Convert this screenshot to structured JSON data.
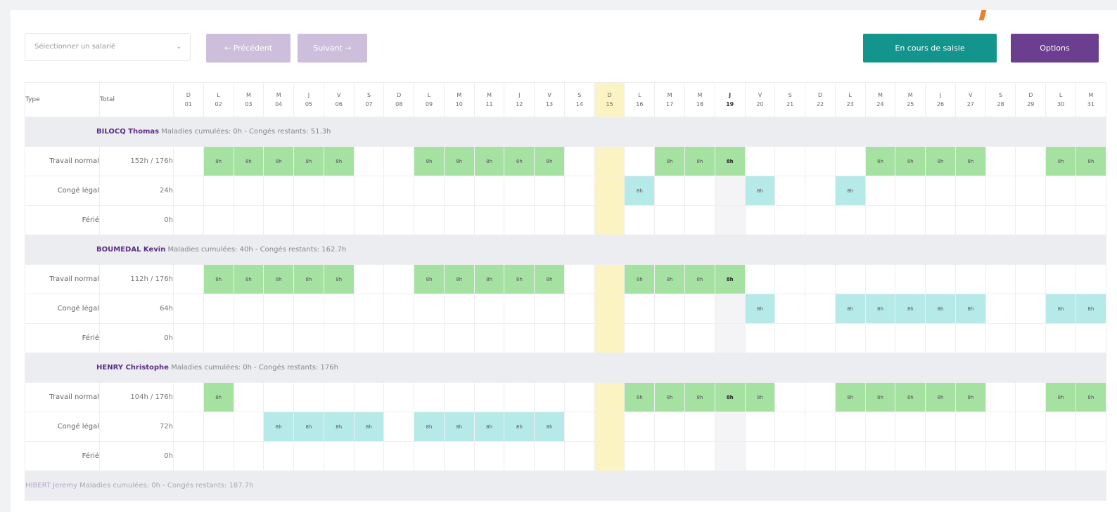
{
  "toolbar": {
    "select_placeholder": "Sélectionner un salarié",
    "prev_label": "← Précédent",
    "next_label": "Suivant →",
    "status_label": "En cours de saisie",
    "options_label": "Options"
  },
  "columns": {
    "type": "Type",
    "total": "Total"
  },
  "days": [
    {
      "l": "D",
      "n": "01"
    },
    {
      "l": "L",
      "n": "02"
    },
    {
      "l": "M",
      "n": "03"
    },
    {
      "l": "M",
      "n": "04"
    },
    {
      "l": "J",
      "n": "05"
    },
    {
      "l": "V",
      "n": "06"
    },
    {
      "l": "S",
      "n": "07"
    },
    {
      "l": "D",
      "n": "08"
    },
    {
      "l": "L",
      "n": "09"
    },
    {
      "l": "M",
      "n": "10"
    },
    {
      "l": "M",
      "n": "11"
    },
    {
      "l": "J",
      "n": "12"
    },
    {
      "l": "V",
      "n": "13"
    },
    {
      "l": "S",
      "n": "14"
    },
    {
      "l": "D",
      "n": "15"
    },
    {
      "l": "L",
      "n": "16"
    },
    {
      "l": "M",
      "n": "17"
    },
    {
      "l": "M",
      "n": "18"
    },
    {
      "l": "J",
      "n": "19"
    },
    {
      "l": "V",
      "n": "20"
    },
    {
      "l": "S",
      "n": "21"
    },
    {
      "l": "D",
      "n": "22"
    },
    {
      "l": "L",
      "n": "23"
    },
    {
      "l": "M",
      "n": "24"
    },
    {
      "l": "M",
      "n": "25"
    },
    {
      "l": "J",
      "n": "26"
    },
    {
      "l": "V",
      "n": "27"
    },
    {
      "l": "S",
      "n": "28"
    },
    {
      "l": "D",
      "n": "29"
    },
    {
      "l": "L",
      "n": "30"
    },
    {
      "l": "M",
      "n": "31"
    }
  ],
  "holiday_day": "15",
  "current_day": "19",
  "colors": {
    "work": "#a5e2a1",
    "leave": "#b6eae9",
    "holiday": "#fbf4c2",
    "brand": "#6c3e8f",
    "status": "#13958d"
  },
  "employees": [
    {
      "name": "BILOCQ Thomas",
      "info": "Maladies cumulées: 0h - Congés restants: 51.3h",
      "rows": [
        {
          "type": "Travail normal",
          "total": "152h / 176h",
          "kind": "w",
          "days": [
            "02",
            "03",
            "04",
            "05",
            "06",
            "09",
            "10",
            "11",
            "12",
            "13",
            "17",
            "18",
            "19",
            "24",
            "25",
            "26",
            "27",
            "30",
            "31"
          ]
        },
        {
          "type": "Congé légal",
          "total": "24h",
          "kind": "l",
          "days": [
            "16",
            "20",
            "23"
          ]
        },
        {
          "type": "Férié",
          "total": "0h",
          "kind": "w",
          "days": []
        }
      ]
    },
    {
      "name": "BOUMEDAL Kevin",
      "info": "Maladies cumulées: 40h - Congés restants: 162.7h",
      "rows": [
        {
          "type": "Travail normal",
          "total": "112h / 176h",
          "kind": "w",
          "days": [
            "02",
            "03",
            "04",
            "05",
            "06",
            "09",
            "10",
            "11",
            "12",
            "13",
            "16",
            "17",
            "18",
            "19"
          ]
        },
        {
          "type": "Congé légal",
          "total": "64h",
          "kind": "l",
          "days": [
            "20",
            "23",
            "24",
            "25",
            "26",
            "27",
            "30",
            "31"
          ]
        },
        {
          "type": "Férié",
          "total": "0h",
          "kind": "w",
          "days": []
        }
      ]
    },
    {
      "name": "HENRY Christophe",
      "info": "Maladies cumulées: 0h - Congés restants: 176h",
      "rows": [
        {
          "type": "Travail normal",
          "total": "104h / 176h",
          "kind": "w",
          "days": [
            "02",
            "16",
            "17",
            "18",
            "19",
            "20",
            "23",
            "24",
            "25",
            "26",
            "27",
            "30",
            "31"
          ]
        },
        {
          "type": "Congé légal",
          "total": "72h",
          "kind": "l",
          "days": [
            "04",
            "05",
            "06",
            "07",
            "09",
            "10",
            "11",
            "12",
            "13"
          ]
        },
        {
          "type": "Férié",
          "total": "0h",
          "kind": "w",
          "days": []
        }
      ]
    }
  ],
  "cell_value": "8h",
  "next_employee": {
    "name": "HIBERT Jeremy",
    "info": "Maladies cumulées: 0h - Congés restants: 187.7h"
  }
}
